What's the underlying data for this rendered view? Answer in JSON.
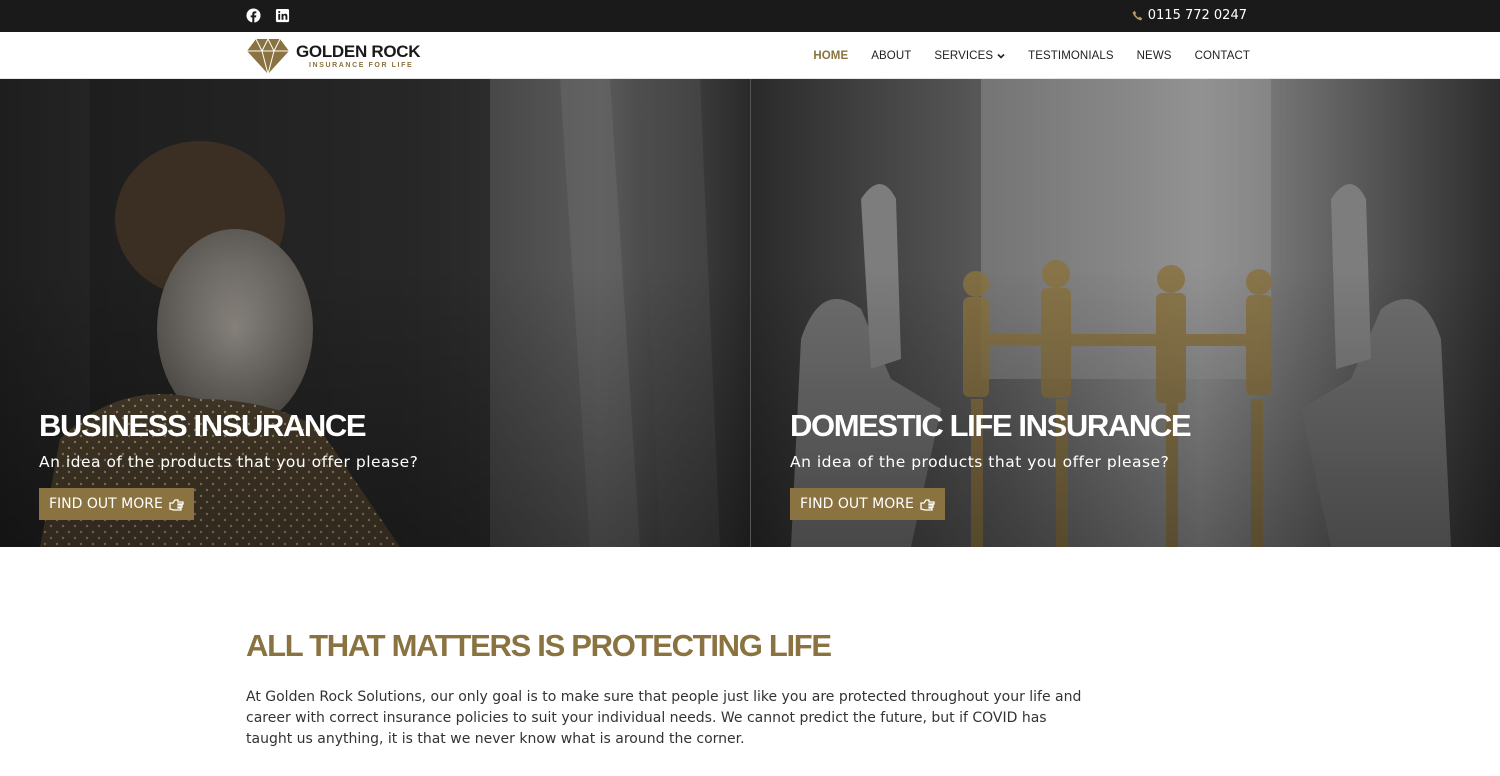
{
  "topbar": {
    "social": [
      {
        "icon": "facebook-icon"
      },
      {
        "icon": "linkedin-icon"
      }
    ],
    "phone": "0115 772 0247"
  },
  "brand": {
    "name": "GOLDEN ROCK",
    "tagline": "INSURANCE FOR LIFE",
    "accent_color": "#8a7340"
  },
  "nav": {
    "items": [
      {
        "label": "HOME",
        "active": true
      },
      {
        "label": "ABOUT"
      },
      {
        "label": "SERVICES",
        "has_dropdown": true
      },
      {
        "label": "TESTIMONIALS"
      },
      {
        "label": "NEWS"
      },
      {
        "label": "CONTACT"
      }
    ]
  },
  "hero": {
    "panels": [
      {
        "title": "BUSINESS INSURANCE",
        "subtitle": "An idea of the products that you offer please?",
        "button": "FIND OUT MORE"
      },
      {
        "title": "DOMESTIC LIFE INSURANCE",
        "subtitle": "An idea of the products that you offer please?",
        "button": "FIND OUT MORE"
      }
    ]
  },
  "about": {
    "heading": "ALL THAT MATTERS IS PROTECTING LIFE",
    "body": "At Golden Rock Solutions, our only goal is to make sure that people just like you are protected throughout your life and career with correct insurance policies to suit your individual needs. We cannot predict the future, but if COVID has taught us anything, it is that we never know what is around the corner."
  }
}
